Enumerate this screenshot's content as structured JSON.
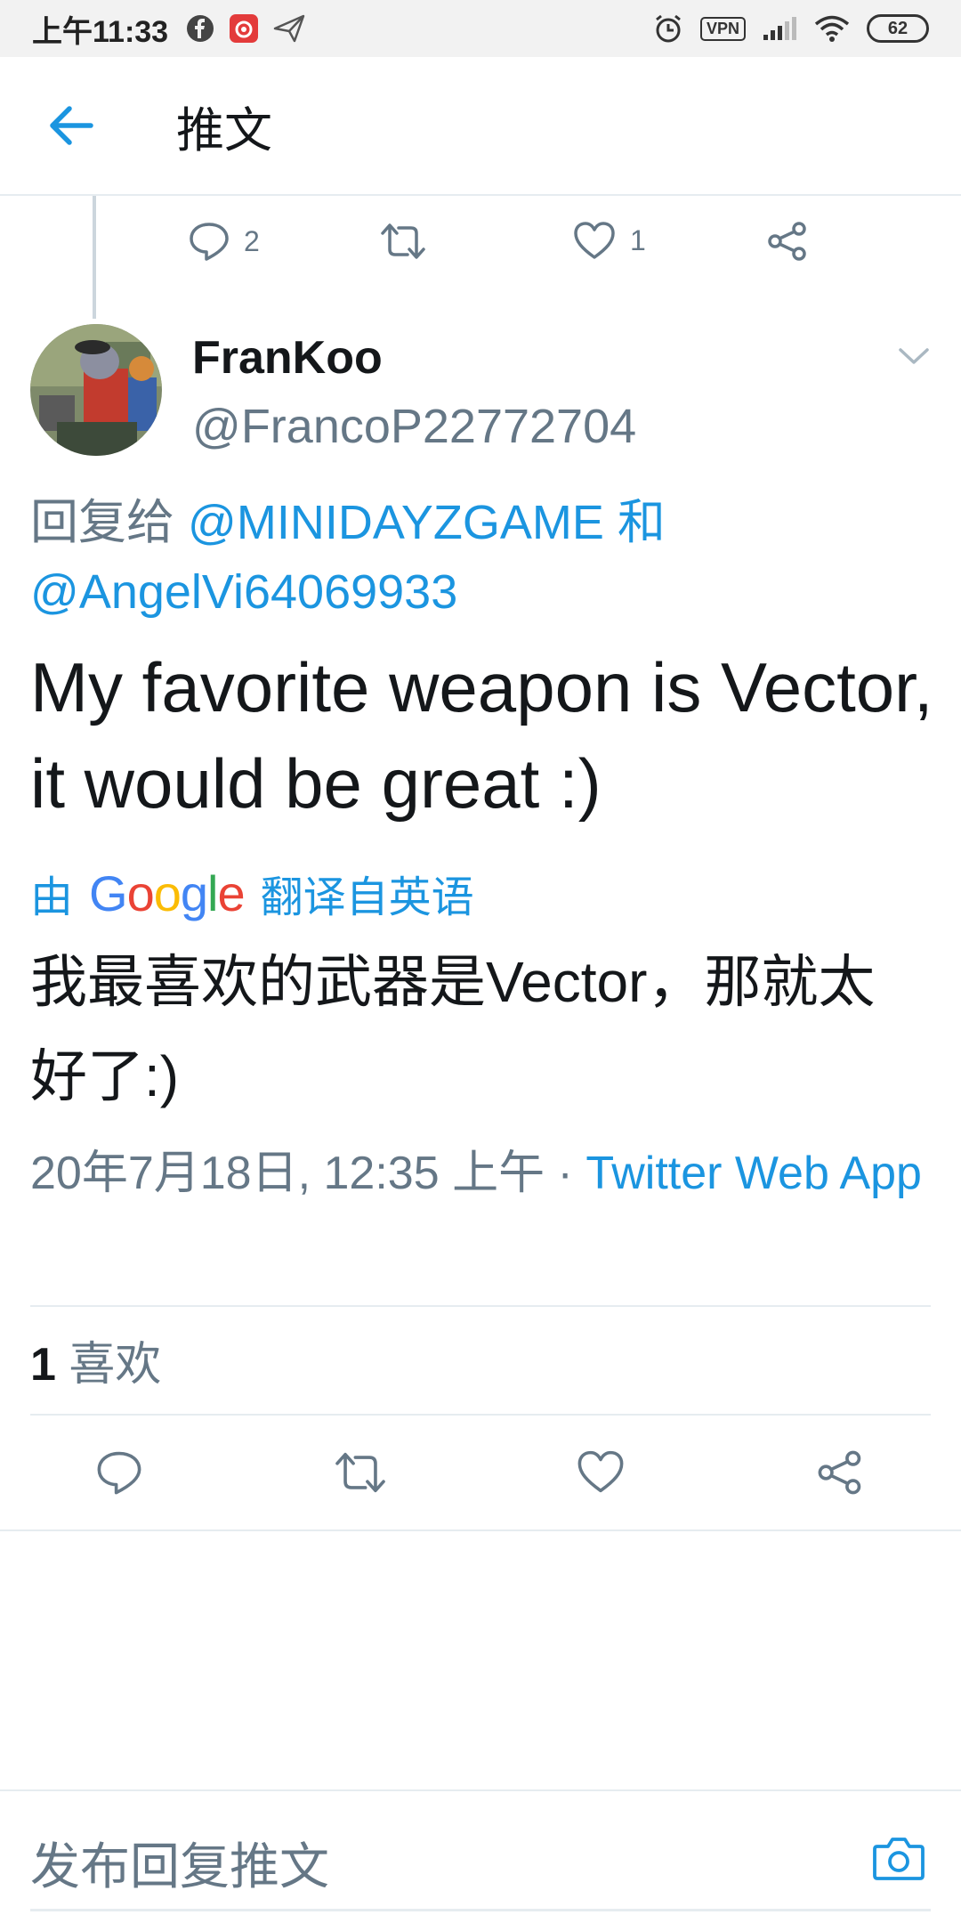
{
  "status_bar": {
    "time": "上午11:33",
    "vpn": "VPN",
    "battery": "62"
  },
  "header": {
    "title": "推文"
  },
  "parent_actions": {
    "reply_count": "2",
    "retweet_count": "",
    "like_count": "1"
  },
  "tweet": {
    "display_name": "FranKoo",
    "handle": "@FrancoP22772704",
    "reply_prefix": "回复给",
    "reply_user_1": "@MINIDAYZGAME",
    "reply_and": "和",
    "reply_user_2": "@AngelVi64069933",
    "text": "My favorite weapon is Vector, it would be great :)",
    "translate_by": "由",
    "translate_google": "Google",
    "translate_suffix": "翻译自英语",
    "translated_text": "我最喜欢的武器是Vector，那就太好了:)",
    "date": "20年7月18日, 12:35 上午",
    "separator": "·",
    "source": "Twitter Web App",
    "likes_count": "1",
    "likes_label": "喜欢"
  },
  "compose": {
    "placeholder": "发布回复推文"
  },
  "colors": {
    "accent": "#1b95e0",
    "secondary_text": "#657786",
    "divider": "#e6ecf0"
  }
}
